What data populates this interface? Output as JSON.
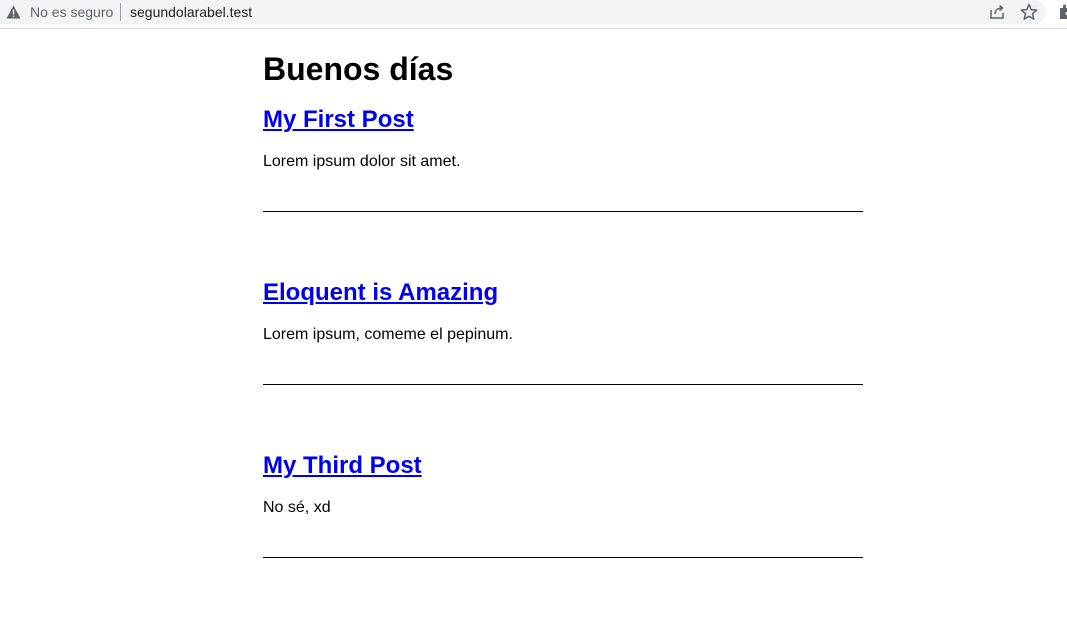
{
  "browser": {
    "security_label": "No es seguro",
    "url": "segundolarabel.test"
  },
  "page": {
    "heading": "Buenos días",
    "posts": [
      {
        "title": "My First Post",
        "excerpt": "Lorem ipsum dolor sit amet."
      },
      {
        "title": "Eloquent is Amazing",
        "excerpt": "Lorem ipsum, comeme el pepinum."
      },
      {
        "title": "My Third Post",
        "excerpt": "No sé, xd"
      }
    ]
  },
  "colors": {
    "link": "#0000ee",
    "text": "#000000"
  }
}
